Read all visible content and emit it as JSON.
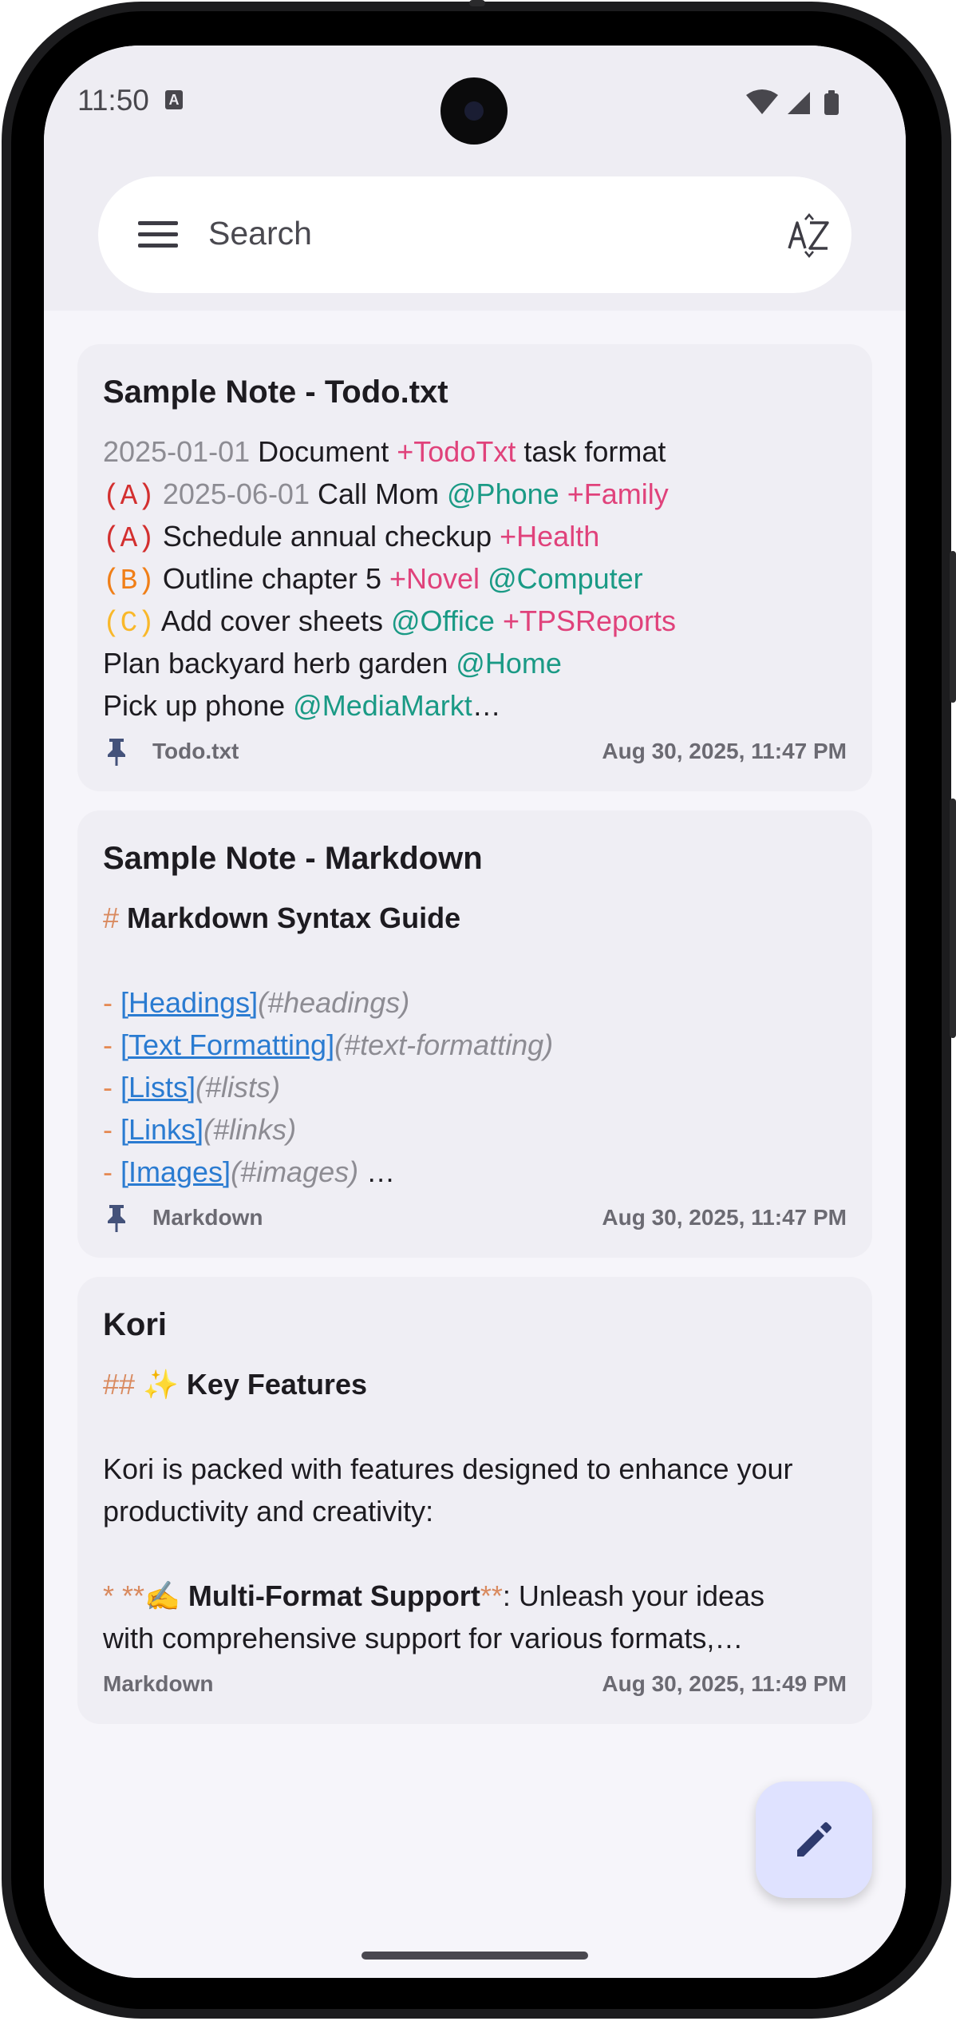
{
  "status_bar": {
    "time": "11:50",
    "notification_icon": "a-icon"
  },
  "search": {
    "placeholder": "Search"
  },
  "notes": [
    {
      "title": "Sample Note - Todo.txt",
      "lines": [
        {
          "segments": [
            {
              "text": "2025-01-01",
              "style": "gray"
            },
            {
              "text": " Document ",
              "style": "plain"
            },
            {
              "text": "+TodoTxt",
              "style": "pink"
            },
            {
              "text": " task format",
              "style": "plain"
            }
          ]
        },
        {
          "segments": [
            {
              "text": "(A)",
              "style": "red"
            },
            {
              "text": " ",
              "style": "plain"
            },
            {
              "text": "2025-06-01",
              "style": "gray"
            },
            {
              "text": " Call Mom ",
              "style": "plain"
            },
            {
              "text": "@Phone",
              "style": "teal"
            },
            {
              "text": " ",
              "style": "plain"
            },
            {
              "text": "+Family",
              "style": "pink"
            }
          ]
        },
        {
          "segments": [
            {
              "text": "(A)",
              "style": "red"
            },
            {
              "text": " Schedule annual checkup ",
              "style": "plain"
            },
            {
              "text": "+Health",
              "style": "pink"
            }
          ]
        },
        {
          "segments": [
            {
              "text": "(B)",
              "style": "orange"
            },
            {
              "text": " Outline chapter 5 ",
              "style": "plain"
            },
            {
              "text": "+Novel",
              "style": "pink"
            },
            {
              "text": " ",
              "style": "plain"
            },
            {
              "text": "@Computer",
              "style": "teal"
            }
          ]
        },
        {
          "segments": [
            {
              "text": "(C)",
              "style": "yellow"
            },
            {
              "text": " Add cover sheets ",
              "style": "plain"
            },
            {
              "text": "@Office",
              "style": "teal"
            },
            {
              "text": " ",
              "style": "plain"
            },
            {
              "text": "+TPSReports",
              "style": "pink"
            }
          ]
        },
        {
          "segments": [
            {
              "text": "Plan backyard herb garden ",
              "style": "plain"
            },
            {
              "text": "@Home",
              "style": "teal"
            }
          ]
        },
        {
          "segments": [
            {
              "text": "Pick up phone ",
              "style": "plain"
            },
            {
              "text": "@MediaMarkt",
              "style": "teal"
            },
            {
              "text": "…",
              "style": "plain"
            }
          ]
        }
      ],
      "format": "Todo.txt",
      "pinned": true,
      "date": "Aug 30, 2025, 11:47 PM"
    },
    {
      "title": "Sample Note - Markdown",
      "lines": [
        {
          "segments": [
            {
              "text": "# ",
              "style": "hash"
            },
            {
              "text": "Markdown Syntax Guide",
              "style": "bold"
            }
          ]
        },
        {
          "segments": []
        },
        {
          "segments": [
            {
              "text": "- ",
              "style": "dash"
            },
            {
              "text": "[Headings]",
              "style": "link"
            },
            {
              "text": "(#headings)",
              "style": "anchor"
            }
          ]
        },
        {
          "segments": [
            {
              "text": "- ",
              "style": "dash"
            },
            {
              "text": "[Text Formatting]",
              "style": "link"
            },
            {
              "text": "(#text-formatting)",
              "style": "anchor"
            }
          ]
        },
        {
          "segments": [
            {
              "text": "- ",
              "style": "dash"
            },
            {
              "text": "[Lists]",
              "style": "link"
            },
            {
              "text": "(#lists)",
              "style": "anchor"
            }
          ]
        },
        {
          "segments": [
            {
              "text": "- ",
              "style": "dash"
            },
            {
              "text": "[Links]",
              "style": "link"
            },
            {
              "text": "(#links)",
              "style": "anchor"
            }
          ]
        },
        {
          "segments": [
            {
              "text": "- ",
              "style": "dash"
            },
            {
              "text": "[Images]",
              "style": "link"
            },
            {
              "text": "(#images)",
              "style": "anchor"
            },
            {
              "text": "  …",
              "style": "plain"
            }
          ]
        }
      ],
      "format": "Markdown",
      "pinned": true,
      "date": "Aug 30, 2025, 11:47 PM"
    },
    {
      "title": "Kori",
      "lines": [
        {
          "segments": [
            {
              "text": "## ",
              "style": "hash"
            },
            {
              "text": "✨ ",
              "style": "plain"
            },
            {
              "text": "Key Features",
              "style": "bold"
            }
          ]
        },
        {
          "segments": []
        },
        {
          "segments": [
            {
              "text": "Kori is packed with features designed to enhance your",
              "style": "plain"
            }
          ]
        },
        {
          "segments": [
            {
              "text": "productivity and creativity:",
              "style": "plain"
            }
          ]
        },
        {
          "segments": []
        },
        {
          "segments": [
            {
              "text": "* **",
              "style": "hash"
            },
            {
              "text": "✍️ ",
              "style": "plain"
            },
            {
              "text": "Multi-Format Support",
              "style": "bold"
            },
            {
              "text": "**",
              "style": "hash"
            },
            {
              "text": ": Unleash your ideas",
              "style": "plain"
            }
          ]
        },
        {
          "segments": [
            {
              "text": "with comprehensive support for various formats,…",
              "style": "plain"
            }
          ]
        }
      ],
      "format": "Markdown",
      "pinned": false,
      "date": "Aug 30, 2025, 11:49 PM"
    }
  ],
  "fab": {
    "icon": "edit-pencil-icon"
  }
}
